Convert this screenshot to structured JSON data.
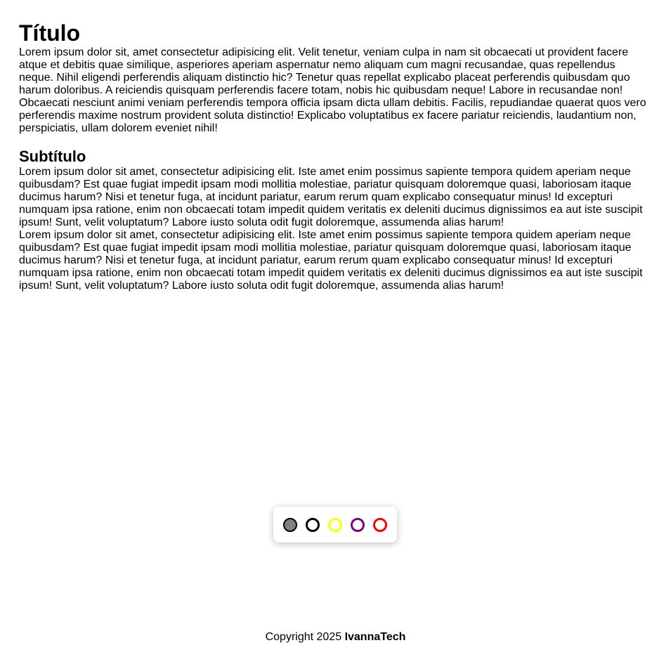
{
  "article": {
    "title": "Título",
    "paragraph1": "Lorem ipsum dolor sit, amet consectetur adipisicing elit. Velit tenetur, veniam culpa in nam sit obcaecati ut provident facere atque et debitis quae similique, asperiores aperiam aspernatur nemo aliquam cum magni recusandae, quas repellendus neque. Nihil eligendi perferendis aliquam distinctio hic? Tenetur quas repellat explicabo placeat perferendis quibusdam quo harum doloribus. A reiciendis quisquam perferendis facere totam, nobis hic quibusdam neque! Labore in recusandae non! Obcaecati nesciunt animi veniam perferendis tempora officia ipsam dicta ullam debitis. Facilis, repudiandae quaerat quos vero perferendis maxime nostrum provident soluta distinctio! Explicabo voluptatibus ex facere pariatur reiciendis, laudantium non, perspiciatis, ullam dolorem eveniet nihil!",
    "subtitle": "Subtítulo",
    "paragraph2": "Lorem ipsum dolor sit amet, consectetur adipisicing elit. Iste amet enim possimus sapiente tempora quidem aperiam neque quibusdam? Est quae fugiat impedit ipsam modi mollitia molestiae, pariatur quisquam doloremque quasi, laboriosam itaque ducimus harum? Nisi et tenetur fuga, at incidunt pariatur, earum rerum quam explicabo consequatur minus! Id excepturi numquam ipsa ratione, enim non obcaecati totam impedit quidem veritatis ex deleniti ducimus dignissimos ea aut iste suscipit ipsum! Sunt, velit voluptatum? Labore iusto soluta odit fugit doloremque, assumenda alias harum!",
    "paragraph3": "Lorem ipsum dolor sit amet, consectetur adipisicing elit. Iste amet enim possimus sapiente tempora quidem aperiam neque quibusdam? Est quae fugiat impedit ipsam modi mollitia molestiae, pariatur quisquam doloremque quasi, laboriosam itaque ducimus harum? Nisi et tenetur fuga, at incidunt pariatur, earum rerum quam explicabo consequatur minus! Id excepturi numquam ipsa ratione, enim non obcaecati totam impedit quidem veritatis ex deleniti ducimus dignissimos ea aut iste suscipit ipsum! Sunt, velit voluptatum? Labore iusto soluta odit fugit doloremque, assumenda alias harum!"
  },
  "palette": {
    "swatches": [
      {
        "name": "gray",
        "border": "#000000",
        "fill": "#808080",
        "selected": true
      },
      {
        "name": "black",
        "border": "#000000",
        "fill": "transparent",
        "selected": false
      },
      {
        "name": "yellow",
        "border": "#ffff00",
        "fill": "transparent",
        "selected": false
      },
      {
        "name": "purple",
        "border": "#800080",
        "fill": "transparent",
        "selected": false
      },
      {
        "name": "red",
        "border": "#ff0000",
        "fill": "transparent",
        "selected": false
      }
    ]
  },
  "footer": {
    "prefix": "Copyright 2025 ",
    "brand": "IvannaTech"
  }
}
